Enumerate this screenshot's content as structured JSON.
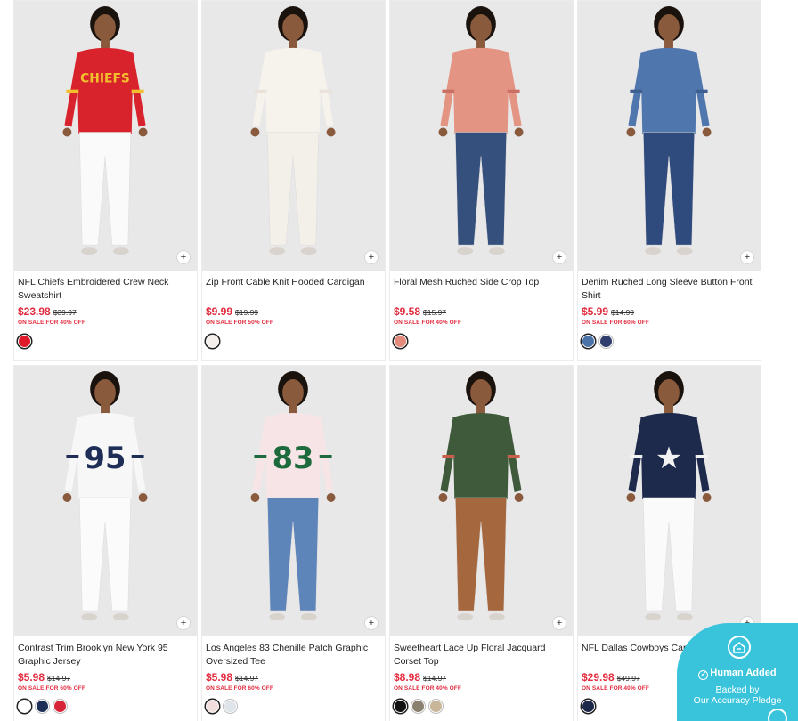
{
  "quick_add_symbol": "+",
  "products": [
    {
      "name": "NFL Chiefs Embroidered Crew Neck Sweatshirt",
      "price": "$23.98",
      "original": "$39.97",
      "sale": "ON SALE FOR 40% OFF",
      "swatches": [
        "#e01a2b"
      ],
      "shirt": "#d8222c",
      "pants": "#fafafa",
      "accent": "#f2c02c",
      "graphic": "CHIEFS"
    },
    {
      "name": "Zip Front Cable Knit Hooded Cardigan",
      "price": "$9.99",
      "original": "$19.99",
      "sale": "ON SALE FOR 50% OFF",
      "swatches": [
        "#f4efea"
      ],
      "shirt": "#f6f2ec",
      "pants": "#f3efe9",
      "accent": "#e8e2da",
      "graphic": ""
    },
    {
      "name": "Floral Mesh Ruched Side Crop Top",
      "price": "$9.58",
      "original": "$15.97",
      "sale": "ON SALE FOR 40% OFF",
      "swatches": [
        "#e38a7d"
      ],
      "shirt": "#e49483",
      "pants": "#36507d",
      "accent": "#c96f64",
      "graphic": ""
    },
    {
      "name": "Denim Ruched Long Sleeve Button Front Shirt",
      "price": "$5.99",
      "original": "$14.99",
      "sale": "ON SALE FOR 60% OFF",
      "swatches": [
        "#4b73a8",
        "#2e3d6b"
      ],
      "shirt": "#4f77ad",
      "pants": "#2f4a7c",
      "accent": "#3d5f92",
      "graphic": ""
    },
    {
      "name": "Contrast Trim Brooklyn New York 95 Graphic Jersey",
      "price": "$5.98",
      "original": "$14.97",
      "sale": "ON SALE FOR 60% OFF",
      "swatches": [
        "#ffffff",
        "#1d2f56",
        "#d72436"
      ],
      "shirt": "#f7f7f7",
      "pants": "#fbfbfb",
      "accent": "#1f2e57",
      "graphic": "95"
    },
    {
      "name": "Los Angeles 83 Chenille Patch Graphic Oversized Tee",
      "price": "$5.98",
      "original": "$14.97",
      "sale": "ON SALE FOR 60% OFF",
      "swatches": [
        "#f3dede",
        "#dde4ea"
      ],
      "shirt": "#f6e4e6",
      "pants": "#5d85ba",
      "accent": "#1d6a3c",
      "graphic": "83"
    },
    {
      "name": "Sweetheart Lace Up Floral Jacquard Corset Top",
      "price": "$8.98",
      "original": "$14.97",
      "sale": "ON SALE FOR 40% OFF",
      "swatches": [
        "#111111",
        "#8a8070",
        "#c9b59a"
      ],
      "shirt": "#3f5a3a",
      "pants": "#a5683e",
      "accent": "#c95e4a",
      "graphic": ""
    },
    {
      "name": "NFL Dallas Cowboys Cardigan",
      "price": "$29.98",
      "original": "$49.97",
      "sale": "ON SALE FOR 40% OFF",
      "swatches": [
        "#1b2848"
      ],
      "shirt": "#1d2a4c",
      "pants": "#fafafa",
      "accent": "#f2f2f2",
      "graphic": "★"
    }
  ],
  "pledge": {
    "added": "Human Added",
    "backed_line1": "Backed by",
    "backed_line2": "Our Accuracy Pledge",
    "color": "#3ac4dc"
  }
}
